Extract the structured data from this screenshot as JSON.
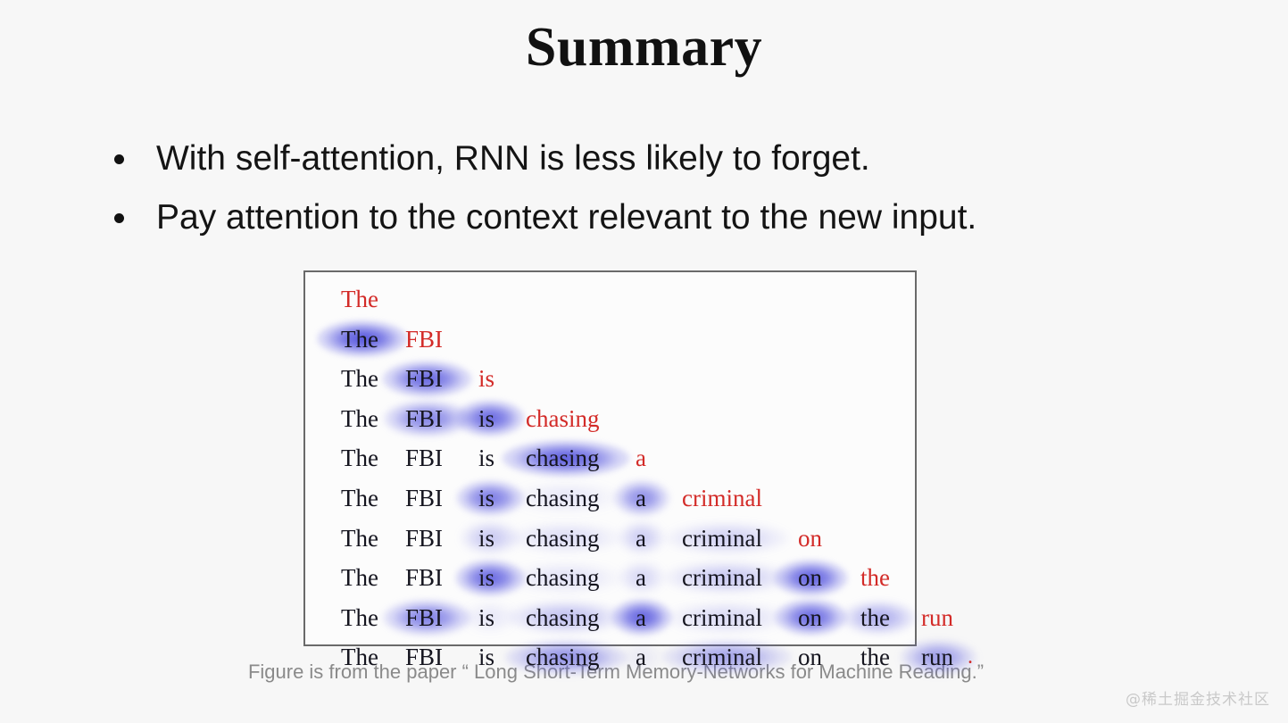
{
  "slide": {
    "title": "Summary",
    "background_color": "#f7f7f7",
    "bullets": [
      "With self-attention, RNN is less likely to forget.",
      "Pay attention to the context relevant to the new input."
    ],
    "caption": "Figure is from the paper “ Long Short-Term Memory-Networks for Machine Reading.”",
    "watermark": "@稀土掘金技术社区"
  },
  "colors": {
    "title_text": "#111111",
    "bullet_text": "#141414",
    "figure_black_word": "#15151f",
    "figure_red_word": "#d32b28",
    "figure_highlight_blue": "#3a3ad8",
    "figure_border": "#6a6a6a",
    "caption_text": "#8a8a8a",
    "watermark_text": "#c9c9c9"
  },
  "figure": {
    "sentence": [
      "The",
      "FBI",
      "is",
      "chasing",
      "a",
      "criminal",
      "on",
      "the",
      "run",
      "."
    ],
    "column_x": [
      18,
      90,
      172,
      225,
      348,
      400,
      530,
      600,
      668,
      720
    ],
    "rows": [
      {
        "index": 1,
        "tokens": [
          {
            "w": "The",
            "c": 0,
            "color": "red",
            "glow": 0.0
          }
        ]
      },
      {
        "index": 2,
        "tokens": [
          {
            "w": "The",
            "c": 0,
            "color": "black",
            "glow": 0.95
          },
          {
            "w": "FBI",
            "c": 1,
            "color": "red",
            "glow": 0.0
          }
        ]
      },
      {
        "index": 3,
        "tokens": [
          {
            "w": "The",
            "c": 0,
            "color": "black",
            "glow": 0.0
          },
          {
            "w": "FBI",
            "c": 1,
            "color": "black",
            "glow": 0.85
          },
          {
            "w": "is",
            "c": 2,
            "color": "red",
            "glow": 0.0
          }
        ]
      },
      {
        "index": 4,
        "tokens": [
          {
            "w": "The",
            "c": 0,
            "color": "black",
            "glow": 0.0
          },
          {
            "w": "FBI",
            "c": 1,
            "color": "black",
            "glow": 0.7
          },
          {
            "w": "is",
            "c": 2,
            "color": "black",
            "glow": 0.85
          },
          {
            "w": "chasing",
            "c": 3,
            "color": "red",
            "glow": 0.0
          }
        ]
      },
      {
        "index": 5,
        "tokens": [
          {
            "w": "The",
            "c": 0,
            "color": "black",
            "glow": 0.0
          },
          {
            "w": "FBI",
            "c": 1,
            "color": "black",
            "glow": 0.0
          },
          {
            "w": "is",
            "c": 2,
            "color": "black",
            "glow": 0.0
          },
          {
            "w": "chasing",
            "c": 3,
            "color": "black",
            "glow": 0.9
          },
          {
            "w": "a",
            "c": 4,
            "color": "red",
            "glow": 0.0
          }
        ]
      },
      {
        "index": 6,
        "tokens": [
          {
            "w": "The",
            "c": 0,
            "color": "black",
            "glow": 0.0
          },
          {
            "w": "FBI",
            "c": 1,
            "color": "black",
            "glow": 0.0
          },
          {
            "w": "is",
            "c": 2,
            "color": "black",
            "glow": 0.75
          },
          {
            "w": "chasing",
            "c": 3,
            "color": "black",
            "glow": 0.12
          },
          {
            "w": "a",
            "c": 4,
            "color": "black",
            "glow": 0.65
          },
          {
            "w": "criminal",
            "c": 5,
            "color": "red",
            "glow": 0.0
          }
        ]
      },
      {
        "index": 7,
        "tokens": [
          {
            "w": "The",
            "c": 0,
            "color": "black",
            "glow": 0.0
          },
          {
            "w": "FBI",
            "c": 1,
            "color": "black",
            "glow": 0.0
          },
          {
            "w": "is",
            "c": 2,
            "color": "black",
            "glow": 0.3
          },
          {
            "w": "chasing",
            "c": 3,
            "color": "black",
            "glow": 0.18
          },
          {
            "w": "a",
            "c": 4,
            "color": "black",
            "glow": 0.28
          },
          {
            "w": "criminal",
            "c": 5,
            "color": "black",
            "glow": 0.25
          },
          {
            "w": "on",
            "c": 6,
            "color": "red",
            "glow": 0.0
          }
        ]
      },
      {
        "index": 8,
        "tokens": [
          {
            "w": "The",
            "c": 0,
            "color": "black",
            "glow": 0.0
          },
          {
            "w": "FBI",
            "c": 1,
            "color": "black",
            "glow": 0.0
          },
          {
            "w": "is",
            "c": 2,
            "color": "black",
            "glow": 0.85
          },
          {
            "w": "chasing",
            "c": 3,
            "color": "black",
            "glow": 0.15
          },
          {
            "w": "a",
            "c": 4,
            "color": "black",
            "glow": 0.22
          },
          {
            "w": "criminal",
            "c": 5,
            "color": "black",
            "glow": 0.3
          },
          {
            "w": "on",
            "c": 6,
            "color": "black",
            "glow": 0.9
          },
          {
            "w": "the",
            "c": 7,
            "color": "red",
            "glow": 0.0
          }
        ]
      },
      {
        "index": 9,
        "tokens": [
          {
            "w": "The",
            "c": 0,
            "color": "black",
            "glow": 0.0
          },
          {
            "w": "FBI",
            "c": 1,
            "color": "black",
            "glow": 0.72
          },
          {
            "w": "is",
            "c": 2,
            "color": "black",
            "glow": 0.12
          },
          {
            "w": "chasing",
            "c": 3,
            "color": "black",
            "glow": 0.35
          },
          {
            "w": "a",
            "c": 4,
            "color": "black",
            "glow": 0.88
          },
          {
            "w": "criminal",
            "c": 5,
            "color": "black",
            "glow": 0.2
          },
          {
            "w": "on",
            "c": 6,
            "color": "black",
            "glow": 0.85
          },
          {
            "w": "the",
            "c": 7,
            "color": "black",
            "glow": 0.45
          },
          {
            "w": "run",
            "c": 8,
            "color": "red",
            "glow": 0.0
          }
        ]
      },
      {
        "index": 10,
        "tokens": [
          {
            "w": "The",
            "c": 0,
            "color": "black",
            "glow": 0.0
          },
          {
            "w": "FBI",
            "c": 1,
            "color": "black",
            "glow": 0.0
          },
          {
            "w": "is",
            "c": 2,
            "color": "black",
            "glow": 0.0
          },
          {
            "w": "chasing",
            "c": 3,
            "color": "black",
            "glow": 0.6
          },
          {
            "w": "a",
            "c": 4,
            "color": "black",
            "glow": 0.08
          },
          {
            "w": "criminal",
            "c": 5,
            "color": "black",
            "glow": 0.5
          },
          {
            "w": "on",
            "c": 6,
            "color": "black",
            "glow": 0.0
          },
          {
            "w": "the",
            "c": 7,
            "color": "black",
            "glow": 0.0
          },
          {
            "w": "run",
            "c": 8,
            "color": "black",
            "glow": 0.55
          },
          {
            "w": ".",
            "c": 9,
            "color": "red",
            "glow": 0.0
          }
        ]
      }
    ]
  }
}
